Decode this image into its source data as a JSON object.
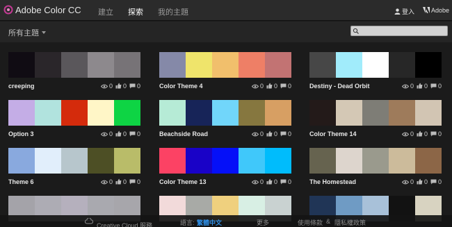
{
  "header": {
    "app_title": "Adobe Color CC",
    "nav": [
      "建立",
      "探索",
      "我的主題"
    ],
    "login_label": "登入",
    "adobe_label": "Adobe"
  },
  "filter": {
    "label": "所有主題",
    "search_placeholder": ""
  },
  "stat_icons": [
    "eye-icon",
    "thumbs-up-icon",
    "comment-icon"
  ],
  "themes": [
    {
      "name": "creeping",
      "views": "0",
      "likes": "0",
      "comments": "0",
      "colors": [
        "#100c13",
        "#2a262a",
        "#5a575b",
        "#8d898d",
        "#777377"
      ]
    },
    {
      "name": "Color Theme 4",
      "views": "0",
      "likes": "0",
      "comments": "0",
      "colors": [
        "#8589a8",
        "#efe46b",
        "#f1bf6c",
        "#ee7f66",
        "#c27373"
      ]
    },
    {
      "name": "Destiny - Dead Orbit",
      "views": "0",
      "likes": "0",
      "comments": "0",
      "colors": [
        "#474747",
        "#a1ecfb",
        "#ffffff",
        "#272727",
        "#000000"
      ]
    },
    {
      "name": "Option 3",
      "views": "0",
      "likes": "0",
      "comments": "0",
      "colors": [
        "#c4ade6",
        "#b1e3de",
        "#d42b0c",
        "#fff6c7",
        "#0ed444"
      ]
    },
    {
      "name": "Beachside Road",
      "views": "0",
      "likes": "0",
      "comments": "0",
      "colors": [
        "#b6ebd6",
        "#172458",
        "#71d6fa",
        "#86773f",
        "#d79f63"
      ]
    },
    {
      "name": "Color Theme 14",
      "views": "0",
      "likes": "0",
      "comments": "0",
      "colors": [
        "#231a19",
        "#d4c8b5",
        "#7e7d76",
        "#9e7b5b",
        "#d2c5b3"
      ]
    },
    {
      "name": "Theme 6",
      "views": "0",
      "likes": "0",
      "comments": "0",
      "colors": [
        "#89a9de",
        "#e1eefb",
        "#b7c6cc",
        "#4d4f25",
        "#b9bc69"
      ]
    },
    {
      "name": "Color Theme 13",
      "views": "0",
      "likes": "0",
      "comments": "0",
      "colors": [
        "#fc4264",
        "#1902c7",
        "#0510f8",
        "#40c8fa",
        "#00bcfc"
      ]
    },
    {
      "name": "The Homestead",
      "views": "0",
      "likes": "0",
      "comments": "0",
      "colors": [
        "#66634f",
        "#ddd5cd",
        "#9a9a8d",
        "#ccbb9b",
        "#8c6647"
      ]
    },
    {
      "name": "",
      "views": "",
      "likes": "",
      "comments": "",
      "colors": [
        "#a4a3a9",
        "#adacb4",
        "#b5b0bd",
        "#a9a9af",
        "#a7a6ab"
      ]
    },
    {
      "name": "",
      "views": "",
      "likes": "",
      "comments": "",
      "colors": [
        "#f2dada",
        "#a8aaa6",
        "#efd07e",
        "#d8efe4",
        "#c9d2d1"
      ]
    },
    {
      "name": "",
      "views": "",
      "likes": "",
      "comments": "",
      "colors": [
        "#203556",
        "#6f9bc4",
        "#a8c1d9",
        "#121212",
        "#d8d3c1"
      ]
    }
  ],
  "footer": {
    "cc_label": "Creative Cloud 服務",
    "lang_label": "語言:",
    "lang_value": "繁體中文",
    "more": "更多",
    "terms": "使用條款",
    "amp": "&",
    "privacy": "隱私權政策"
  }
}
